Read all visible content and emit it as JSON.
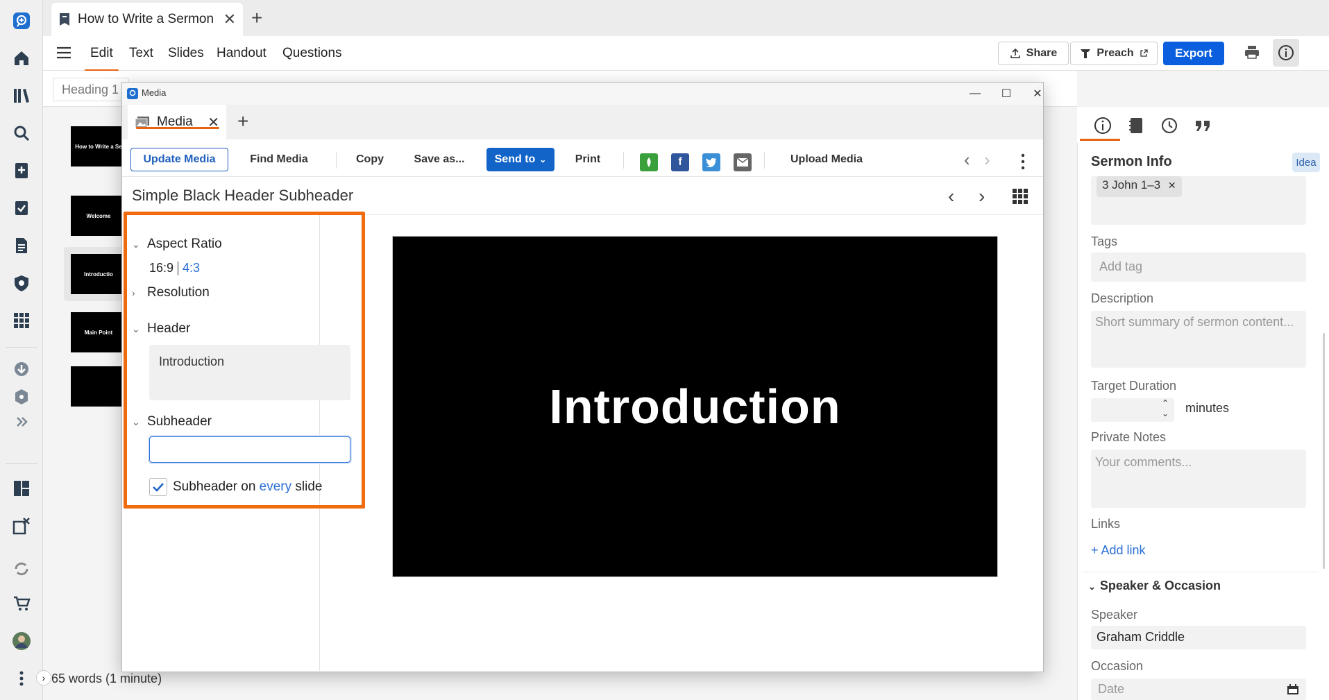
{
  "app": {
    "doc_tab_title": "How to Write a Sermon",
    "word_count": "65 words (1 minute)"
  },
  "menu": {
    "items": [
      "Edit",
      "Text",
      "Slides",
      "Handout",
      "Questions"
    ],
    "share_label": "Share",
    "preach_label": "Preach",
    "export_label": "Export"
  },
  "format_bar": {
    "heading_select": "Heading 1"
  },
  "thumbnails": [
    {
      "label": "How to Write a Se"
    },
    {
      "label": "Welcome"
    },
    {
      "label": "Introductio"
    },
    {
      "label": "Main Point"
    },
    {
      "label": ""
    }
  ],
  "media_window": {
    "window_title": "Media",
    "tab_label": "Media",
    "toolbar": {
      "update_media": "Update Media",
      "find_media": "Find Media",
      "copy": "Copy",
      "save_as": "Save as...",
      "send_to": "Send to",
      "print": "Print",
      "upload_media": "Upload Media"
    },
    "template_name": "Simple Black Header Subheader",
    "settings": {
      "aspect_ratio_label": "Aspect Ratio",
      "ratio_selected": "16:9",
      "ratio_alt": "4:3",
      "resolution_label": "Resolution",
      "header_label": "Header",
      "header_value": "Introduction",
      "subheader_label": "Subheader",
      "subheader_value": "",
      "checkbox_pre": "Subheader on ",
      "checkbox_highlight": "every",
      "checkbox_post": " slide",
      "checkbox_checked": true
    },
    "preview_text": "Introduction"
  },
  "right_panel": {
    "title": "Sermon Info",
    "badge": "Idea",
    "passage_chip": "3 John 1–3",
    "tags_label": "Tags",
    "tags_placeholder": "Add tag",
    "description_label": "Description",
    "description_placeholder": "Short summary of sermon content...",
    "target_duration_label": "Target Duration",
    "minutes_label": "minutes",
    "private_notes_label": "Private Notes",
    "private_notes_placeholder": "Your comments...",
    "links_label": "Links",
    "add_link": "+ Add link",
    "speaker_section": "Speaker & Occasion",
    "speaker_label": "Speaker",
    "speaker_value": "Graham Criddle",
    "occasion_label": "Occasion",
    "occasion_placeholder": "Date"
  },
  "colors": {
    "accent_orange": "#f06a0e",
    "primary_blue": "#0b5fde"
  }
}
